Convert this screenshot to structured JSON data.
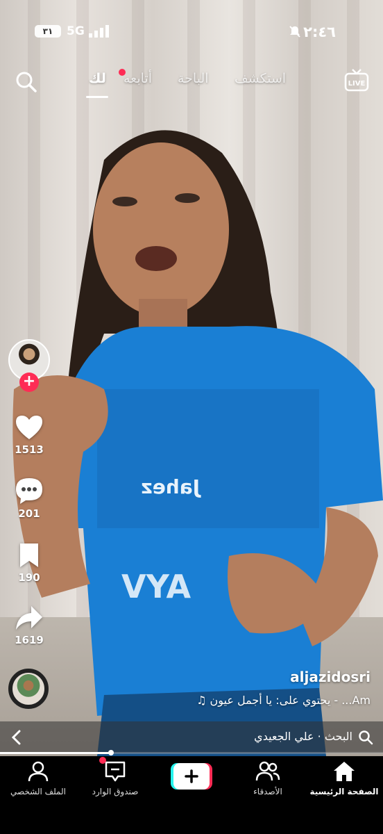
{
  "status_bar": {
    "time": "٢:٤٦",
    "network": "5G",
    "battery": "٣١"
  },
  "top_nav": {
    "tabs": [
      {
        "label": "لك",
        "active": true
      },
      {
        "label": "أتابعه",
        "active": false,
        "has_dot": true
      },
      {
        "label": "الباحة",
        "active": false
      },
      {
        "label": "استكشف",
        "active": false
      }
    ],
    "live_label": "LIVE"
  },
  "actions": {
    "likes": "1513",
    "comments": "201",
    "saves": "190",
    "shares": "1619"
  },
  "post": {
    "username": "aljazidosri",
    "sound_text": "يحتوي على: يا أجمل عيون - ...Am"
  },
  "search_bar": {
    "text": "البحث · علي الجعيدي",
    "progress": 0.29
  },
  "bottom_nav": {
    "items": [
      {
        "label": "الصفحة الرئيسية",
        "icon": "home-icon",
        "active": true
      },
      {
        "label": "الأصدقاء",
        "icon": "friends-icon",
        "active": false
      },
      {
        "label": "",
        "icon": "create-icon",
        "active": false
      },
      {
        "label": "صندوق الوارد",
        "icon": "inbox-icon",
        "active": false,
        "has_dot": true
      },
      {
        "label": "الملف الشخصي",
        "icon": "profile-icon",
        "active": false
      }
    ]
  },
  "colors": {
    "accent": "#fe2c55",
    "jersey": "#1a7fd4",
    "background": "#000000"
  }
}
